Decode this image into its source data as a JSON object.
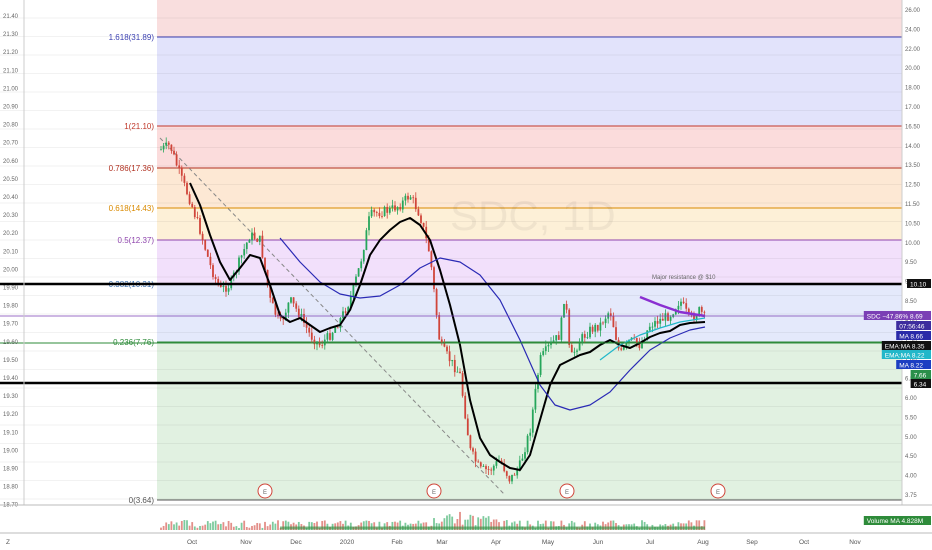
{
  "chart_data": {
    "type": "candlestick",
    "left_axis_ticks": [
      "21.40",
      "21.30",
      "21.20",
      "21.10",
      "21.00",
      "20.90",
      "20.80",
      "20.70",
      "20.60",
      "20.50",
      "20.40",
      "20.30",
      "20.20",
      "20.10",
      "20.00",
      "19.90",
      "19.80",
      "19.70",
      "19.60",
      "19.50",
      "19.40",
      "19.30",
      "19.20",
      "19.10",
      "19.00",
      "18.90",
      "18.80",
      "18.70"
    ],
    "right_axis_ticks": [
      "26.00",
      "24.00",
      "22.00",
      "20.00",
      "18.00",
      "17.00",
      "16.50",
      "14.00",
      "13.50",
      "12.50",
      "11.50",
      "10.50",
      "10.00",
      "9.50",
      "9.00",
      "8.50",
      "8.00",
      "7.50",
      "7.00",
      "6.50",
      "6.00",
      "5.50",
      "5.00",
      "4.50",
      "4.00",
      "3.75"
    ],
    "x_labels": [
      "Oct",
      "Nov",
      "Dec",
      "2020",
      "Feb",
      "Mar",
      "Apr",
      "May",
      "Jun",
      "Jul",
      "Aug",
      "Sep",
      "Oct",
      "Nov"
    ],
    "fib_levels": [
      {
        "label": "1.618(31.89)",
        "color": "#3a3fb0"
      },
      {
        "label": "1(21.10)",
        "color": "#c0392b"
      },
      {
        "label": "0.786(17.36)",
        "color": "#b03020"
      },
      {
        "label": "0.618(14.43)",
        "color": "#d98a00"
      },
      {
        "label": "0.5(12.37)",
        "color": "#8e44ad"
      },
      {
        "label": "0.382(10.31)",
        "color": "#3a6fb0"
      },
      {
        "label": "0.236(7.76)",
        "color": "#2e8b3a"
      },
      {
        "label": "0(3.64)",
        "color": "#555555"
      }
    ],
    "annotation": "Major resistance @ $10",
    "watermark": "SDC, 1D",
    "earnings_markers": [
      "E",
      "E",
      "E",
      "E"
    ],
    "price_tags": [
      {
        "text": "10.10",
        "bg": "#111111"
      },
      {
        "text": "SDC −47.86%  8.69",
        "bg": "#7a3fb5"
      },
      {
        "text": "07:56:46",
        "bg": "#3d2c9e"
      },
      {
        "text": "MA  8.66",
        "bg": "#2a2aa8"
      },
      {
        "text": "EMA:MA  8.35",
        "bg": "#111111"
      },
      {
        "text": "EMA:MA  8.22",
        "bg": "#22b7c9"
      },
      {
        "text": "MA  8.22",
        "bg": "#1c3ec2"
      },
      {
        "text": "7.66",
        "bg": "#2a8f4a"
      },
      {
        "text": "6.34",
        "bg": "#111111"
      }
    ],
    "volume_tags": [
      {
        "text": "Volume MA  4.828M",
        "bg": "#2e8b3a"
      }
    ],
    "bottom_axis_left": "Z"
  }
}
